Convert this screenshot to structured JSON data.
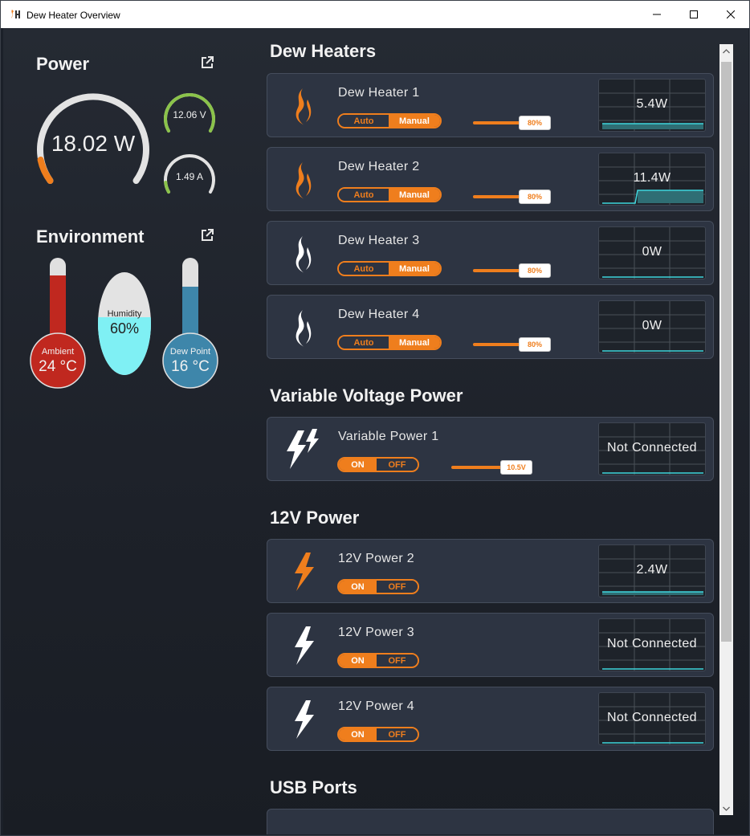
{
  "window": {
    "title": "Dew Heater Overview"
  },
  "power": {
    "heading": "Power",
    "total": "18.02 W",
    "voltage": "12.06 V",
    "current": "1.49 A"
  },
  "environment": {
    "heading": "Environment",
    "ambient_label": "Ambient",
    "ambient_value": "24 °C",
    "humidity_label": "Humidity",
    "humidity_value": "60%",
    "dewpoint_label": "Dew Point",
    "dewpoint_value": "16 °C"
  },
  "groups": {
    "dew_heaters": "Dew Heaters",
    "variable": "Variable Voltage Power",
    "v12": "12V Power",
    "usb": "USB Ports"
  },
  "dew_heaters": [
    {
      "name": "Dew Heater 1",
      "auto": "Auto",
      "manual": "Manual",
      "level": "80%",
      "readout": "5.4W"
    },
    {
      "name": "Dew Heater 2",
      "auto": "Auto",
      "manual": "Manual",
      "level": "80%",
      "readout": "11.4W"
    },
    {
      "name": "Dew Heater 3",
      "auto": "Auto",
      "manual": "Manual",
      "level": "80%",
      "readout": "0W"
    },
    {
      "name": "Dew Heater 4",
      "auto": "Auto",
      "manual": "Manual",
      "level": "80%",
      "readout": "0W"
    }
  ],
  "variable_power": [
    {
      "name": "Variable Power 1",
      "on": "ON",
      "off": "OFF",
      "level": "10.5V",
      "readout": "Not Connected"
    }
  ],
  "power_12v": [
    {
      "name": "12V Power 2",
      "on": "ON",
      "off": "OFF",
      "readout": "2.4W"
    },
    {
      "name": "12V Power 3",
      "on": "ON",
      "off": "OFF",
      "readout": "Not Connected"
    },
    {
      "name": "12V Power 4",
      "on": "ON",
      "off": "OFF",
      "readout": "Not Connected"
    }
  ],
  "colors": {
    "accent": "#ef7e1d",
    "card": "#2d3442",
    "chart_line": "#3fd6dd",
    "good": "#8bc34a"
  }
}
